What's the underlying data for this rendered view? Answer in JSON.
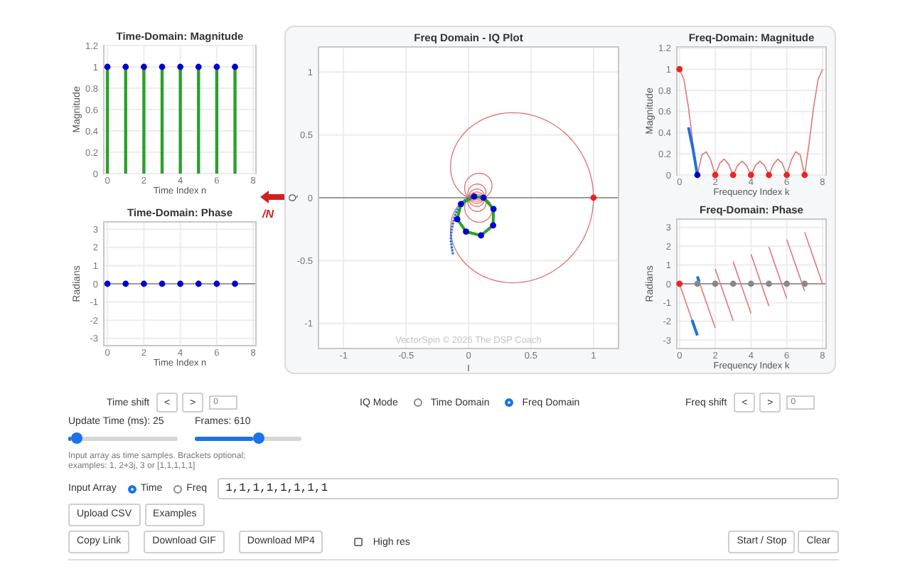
{
  "time_magnitude": {
    "chart_data": {
      "type": "bar",
      "title": "Time-Domain: Magnitude",
      "xlabel": "Time Index n",
      "ylabel": "Magnitude",
      "grid": true,
      "x": [
        0,
        1,
        2,
        3,
        4,
        5,
        6,
        7
      ],
      "xlim": [
        -0.2,
        8.15
      ],
      "ylim": [
        0,
        1.2
      ],
      "xticks": [
        0,
        2,
        4,
        6,
        8
      ],
      "yticks": [
        0,
        0.2,
        0.4,
        0.6,
        0.8,
        1,
        1.2
      ],
      "series": [
        {
          "color": "#2ca02c",
          "values": [
            1,
            1,
            1,
            1,
            1,
            1,
            1,
            1
          ]
        },
        {
          "type": "scatter",
          "color": "#0000cc",
          "values": [
            1,
            1,
            1,
            1,
            1,
            1,
            1,
            1
          ]
        }
      ]
    }
  },
  "time_phase": {
    "chart_data": {
      "type": "scatter",
      "title": "Time-Domain: Phase",
      "xlabel": "Time Index n",
      "ylabel": "Radians",
      "grid": true,
      "x": [
        0,
        1,
        2,
        3,
        4,
        5,
        6,
        7
      ],
      "xlim": [
        -0.2,
        8.15
      ],
      "ylim": [
        -3.4,
        3.4
      ],
      "xticks": [
        0,
        2,
        4,
        6,
        8
      ],
      "yticks": [
        -3,
        -2,
        -1,
        0,
        1,
        2,
        3
      ],
      "series": [
        {
          "color": "#0000cc",
          "values": [
            0,
            0,
            0,
            0,
            0,
            0,
            0,
            0
          ]
        }
      ]
    }
  },
  "division_marker": {
    "text": "/N"
  },
  "iq_plot": {
    "chart_data": {
      "type": "scatter",
      "title": "Freq Domain - IQ Plot",
      "xlabel": "I",
      "ylabel": "Q",
      "grid": true,
      "xlim": [
        -1.2,
        1.2
      ],
      "ylim": [
        -1.2,
        1.2
      ],
      "xticks": [
        -1,
        -0.5,
        0,
        0.5,
        1
      ],
      "yticks": [
        -1,
        -0.5,
        0,
        0.5,
        1
      ],
      "x": [
        0.045,
        0.12,
        0.2,
        0.197,
        0.1,
        -0.02,
        -0.09,
        -0.06,
        1
      ],
      "series": [
        {
          "color": "#0000cc",
          "values": [
            0.01,
            0,
            -0.09,
            -0.22,
            -0.3,
            -0.27,
            -0.17,
            -0.05,
            null
          ]
        },
        {
          "color": "#ee2222",
          "values": [
            null,
            null,
            null,
            null,
            null,
            null,
            null,
            null,
            0
          ]
        }
      ],
      "annotations": [
        "VectorSpin © 2026 The DSP Coach"
      ]
    }
  },
  "freq_magnitude": {
    "chart_data": {
      "type": "line",
      "title": "Freq-Domain: Magnitude",
      "xlabel": "Frequency Index k",
      "ylabel": "Magnitude",
      "grid": true,
      "xlim": [
        -0.15,
        8.2
      ],
      "ylim": [
        0,
        1.21
      ],
      "xticks": [
        0,
        2,
        4,
        6,
        8
      ],
      "yticks": [
        0,
        0.2,
        0.4,
        0.6,
        0.8,
        1,
        1.2
      ],
      "x": [
        0,
        0.25,
        0.5,
        0.75,
        1,
        1.25,
        1.5,
        1.75,
        2,
        2.25,
        2.5,
        2.75,
        3,
        3.25,
        3.5,
        3.75,
        4,
        4.25,
        4.5,
        4.75,
        5,
        5.25,
        5.5,
        5.75,
        6,
        6.25,
        6.5,
        6.75,
        7,
        7.25,
        7.5,
        7.75,
        8
      ],
      "series": [
        {
          "color": "#e07878",
          "values": [
            1,
            0.9,
            0.64,
            0.3,
            0,
            0.19,
            0.22,
            0.14,
            0,
            0.11,
            0.15,
            0.1,
            0,
            0.09,
            0.13,
            0.09,
            0,
            0.09,
            0.13,
            0.09,
            0,
            0.1,
            0.15,
            0.11,
            0,
            0.14,
            0.22,
            0.19,
            0,
            0.3,
            0.64,
            0.9,
            1
          ]
        },
        {
          "color": "#2070e0",
          "values": [
            null,
            null,
            0.45,
            0.25,
            0,
            null,
            null,
            null,
            null,
            null,
            null,
            null,
            null,
            null,
            null,
            null,
            null,
            null,
            null,
            null,
            null,
            null,
            null,
            null,
            null,
            null,
            null,
            null,
            null,
            null,
            null,
            null,
            null
          ]
        },
        {
          "color": "#ee2222",
          "type": "scatter",
          "values": [
            1,
            null,
            null,
            null,
            null,
            null,
            null,
            null,
            0,
            null,
            null,
            null,
            0,
            null,
            null,
            null,
            0,
            null,
            null,
            null,
            0,
            null,
            null,
            null,
            0,
            null,
            null,
            null,
            0,
            null,
            null,
            null,
            null
          ]
        },
        {
          "color": "#0000cc",
          "type": "scatter",
          "values": [
            null,
            null,
            null,
            null,
            0,
            null,
            null,
            null,
            null,
            null,
            null,
            null,
            null,
            null,
            null,
            null,
            null,
            null,
            null,
            null,
            null,
            null,
            null,
            null,
            null,
            null,
            null,
            null,
            null,
            null,
            null,
            null,
            null
          ]
        }
      ]
    }
  },
  "freq_phase": {
    "chart_data": {
      "type": "line",
      "title": "Freq-Domain: Phase",
      "xlabel": "Frequency Index k",
      "ylabel": "Radians",
      "grid": true,
      "xlim": [
        -0.15,
        8.2
      ],
      "ylim": [
        -3.45,
        3.45
      ],
      "xticks": [
        0,
        2,
        4,
        6,
        8
      ],
      "yticks": [
        -3,
        -2,
        -1,
        0,
        1,
        2,
        3
      ],
      "x": [
        0,
        0.7,
        1,
        1.1,
        2,
        3,
        4,
        5,
        6,
        7,
        8
      ],
      "series": [
        {
          "color": "#e07878",
          "values": [
            0,
            -1.93,
            null,
            null,
            null,
            null,
            null,
            null,
            null,
            null,
            null
          ]
        },
        {
          "color": "#e07878",
          "values": [
            null,
            null,
            null,
            0.11,
            -2.36,
            null,
            null,
            null,
            null,
            null,
            null
          ]
        },
        {
          "color": "#e07878",
          "values": [
            null,
            null,
            null,
            null,
            0.79,
            -1.96,
            null,
            null,
            null,
            null,
            null
          ]
        },
        {
          "color": "#e07878",
          "values": [
            null,
            null,
            null,
            null,
            null,
            1.18,
            -1.57,
            null,
            null,
            null,
            null
          ]
        },
        {
          "color": "#e07878",
          "values": [
            null,
            null,
            null,
            null,
            null,
            null,
            1.57,
            -1.18,
            null,
            null,
            null
          ]
        },
        {
          "color": "#e07878",
          "values": [
            null,
            null,
            null,
            null,
            null,
            null,
            null,
            1.96,
            -0.79,
            null,
            null
          ]
        },
        {
          "color": "#e07878",
          "values": [
            null,
            null,
            null,
            null,
            null,
            null,
            null,
            null,
            2.36,
            -0.39,
            null
          ]
        },
        {
          "color": "#e07878",
          "values": [
            null,
            null,
            null,
            null,
            null,
            null,
            null,
            null,
            null,
            2.75,
            0
          ]
        },
        {
          "color": "#2070e0",
          "values": [
            null,
            -1.93,
            -2.75,
            null,
            null,
            null,
            null,
            null,
            null,
            null,
            null
          ]
        },
        {
          "color": "#2070e0",
          "values": [
            null,
            null,
            0.39,
            0.11,
            null,
            null,
            null,
            null,
            null,
            null,
            null
          ]
        },
        {
          "color": "#888888",
          "type": "scatter",
          "values": [
            null,
            null,
            0,
            null,
            0,
            0,
            0,
            0,
            0,
            0,
            null
          ]
        },
        {
          "color": "#ee2222",
          "type": "scatter",
          "values": [
            0,
            null,
            null,
            null,
            null,
            null,
            null,
            null,
            null,
            null,
            null
          ]
        }
      ]
    }
  },
  "time_shift": {
    "label": "Time shift",
    "buttons": [
      "<",
      ">"
    ],
    "placeholder": "0"
  },
  "iq_mode": {
    "label": "IQ Mode",
    "options": [
      {
        "label": "Time Domain",
        "selected": false
      },
      {
        "label": "Freq Domain",
        "selected": true
      }
    ]
  },
  "freq_shift": {
    "label": "Freq shift",
    "buttons": [
      "<",
      ">"
    ],
    "placeholder": "0"
  },
  "sliders": [
    {
      "label": "Update Time (ms): 25",
      "level": 0.08
    },
    {
      "label": "Frames: 610",
      "level": 0.6
    }
  ],
  "help_lines": [
    "Input array as time samples. Brackets optional;",
    "examples: 1, 2+3j, 3 or [1,1,1,1,1]"
  ],
  "input_array": {
    "label": "Input Array",
    "options": [
      {
        "label": "Time",
        "selected": true
      },
      {
        "label": "Freq",
        "selected": false
      }
    ],
    "value": "1,1,1,1,1,1,1,1"
  },
  "file_buttons": [
    "Upload CSV",
    "Examples"
  ],
  "export_buttons": [
    "Copy Link",
    "Download GIF",
    "Download MP4"
  ],
  "high_res": {
    "label": "High res",
    "checked": false
  },
  "run_buttons": [
    "Start / Stop",
    "Clear"
  ]
}
